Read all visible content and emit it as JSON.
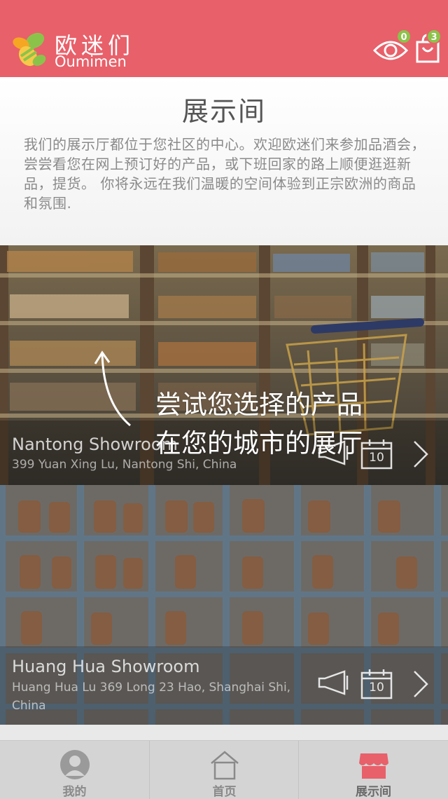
{
  "header": {
    "brand_cn": "欧迷们",
    "brand_en": "Oumimen",
    "eye_count": "0",
    "cart_count": "3"
  },
  "page": {
    "title": "展示间",
    "description": "我们的展示厅都位于您社区的中心。欢迎欧迷们来参加品酒会，尝尝看您在网上预订好的产品，或下班回家的路上顺便逛逛新品，提货。 你将永远在我们温暖的空间体验到正宗欧洲的商品和氛围."
  },
  "hint": {
    "text": "尝试您选择的产品在您的城市的展厅"
  },
  "showrooms": [
    {
      "name": "Nantong Showroom",
      "address": "399 Yuan Xing Lu, Nantong Shi, China",
      "calendar_day": "10"
    },
    {
      "name": "Huang Hua Showroom",
      "address": "Huang Hua Lu 369 Long 23 Hao, Shanghai Shi, China",
      "calendar_day": "10"
    }
  ],
  "nav": {
    "items": [
      {
        "label": "我的",
        "icon": "profile-icon"
      },
      {
        "label": "首页",
        "icon": "home-icon"
      },
      {
        "label": "展示间",
        "icon": "store-icon",
        "active": true
      }
    ]
  },
  "colors": {
    "header": "#e8606a",
    "badge": "#8bc34a",
    "active_nav": "#e8606a"
  }
}
